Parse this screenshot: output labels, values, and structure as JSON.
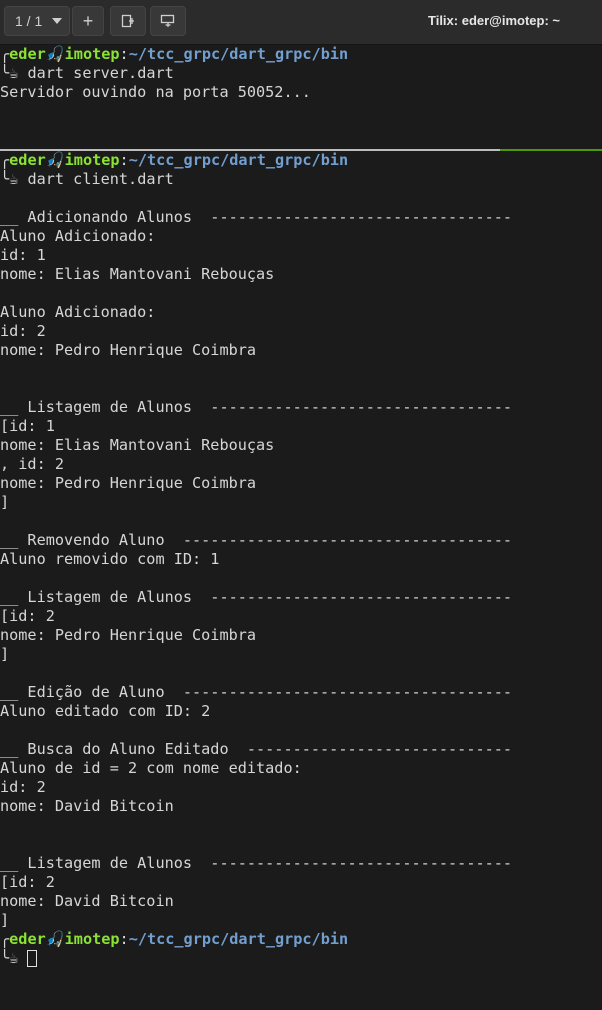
{
  "titlebar": {
    "session_label": "1 / 1",
    "add_label": "+",
    "title": "Tilix: eder@imotep: ~"
  },
  "prompt": {
    "user": "eder",
    "host_icon": "🎣",
    "host": "imotep",
    "sep": ":",
    "path": "~/tcc_grpc/dart_grpc/bin",
    "cmd_icon": "☕"
  },
  "top_pane": {
    "command": "dart server.dart",
    "output": [
      "Servidor ouvindo na porta 50052..."
    ]
  },
  "bottom_pane": {
    "command": "dart client.dart",
    "output": [
      "",
      "__ Adicionando Alunos  ---------------------------------",
      "Aluno Adicionado:",
      "id: 1",
      "nome: Elias Mantovani Rebouças",
      "",
      "Aluno Adicionado:",
      "id: 2",
      "nome: Pedro Henrique Coimbra",
      "",
      "",
      "__ Listagem de Alunos  ---------------------------------",
      "[id: 1",
      "nome: Elias Mantovani Rebouças",
      ", id: 2",
      "nome: Pedro Henrique Coimbra",
      "]",
      "",
      "__ Removendo Aluno  ------------------------------------",
      "Aluno removido com ID: 1",
      "",
      "__ Listagem de Alunos  ---------------------------------",
      "[id: 2",
      "nome: Pedro Henrique Coimbra",
      "]",
      "",
      "__ Edição de Aluno  ------------------------------------",
      "Aluno editado com ID: 2",
      "",
      "__ Busca do Aluno Editado  -----------------------------",
      "Aluno de id = 2 com nome editado:",
      "id: 2",
      "nome: David Bitcoin",
      "",
      "",
      "__ Listagem de Alunos  ---------------------------------",
      "[id: 2",
      "nome: David Bitcoin",
      "]"
    ]
  }
}
